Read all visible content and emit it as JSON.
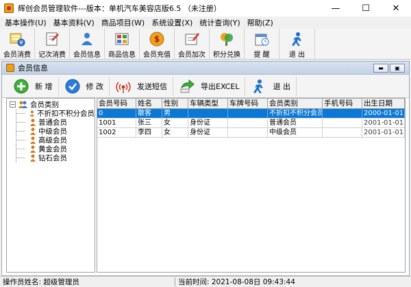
{
  "app": {
    "title": "辉创会员管理软件---版本：单机汽车美容店版6.5 （未注册）"
  },
  "window_controls": {
    "minimize": "—",
    "maximize": "☐",
    "close": "✕"
  },
  "menu": [
    "基本操作(U)",
    "基本资料(V)",
    "商品项目(W)",
    "系统设置(X)",
    "统计查询(Y)",
    "帮助(Z)"
  ],
  "toolbar": [
    {
      "label": "会员消费",
      "icon": "member-consume-icon"
    },
    {
      "label": "记次消费",
      "icon": "count-consume-icon"
    },
    {
      "label": "会员信息",
      "icon": "member-info-icon"
    },
    {
      "label": "商品信息",
      "icon": "product-info-icon"
    },
    {
      "label": "会员充值",
      "icon": "recharge-icon"
    },
    {
      "label": "会员加次",
      "icon": "add-count-icon"
    },
    {
      "label": "积分兑换",
      "icon": "points-exchange-icon"
    },
    {
      "label": "提  醒",
      "icon": "reminder-icon"
    },
    {
      "label": "退  出",
      "icon": "exit-icon"
    }
  ],
  "child_window": {
    "title": "会员信息",
    "buttons": {
      "minimize": "▬",
      "restore": "▣"
    },
    "actions": [
      {
        "label": "新  增",
        "icon": "add-icon"
      },
      {
        "label": "修  改",
        "icon": "edit-icon"
      },
      {
        "label": "发送短信",
        "icon": "sms-icon"
      },
      {
        "label": "导出EXCEL",
        "icon": "export-excel-icon"
      },
      {
        "label": "退  出",
        "icon": "exit-icon"
      }
    ]
  },
  "tree": {
    "root": "会员类别",
    "toggle": "−",
    "children": [
      "不折扣不积分会员",
      "普通会员",
      "中级会员",
      "高级会员",
      "黄金会员",
      "钻石会员"
    ]
  },
  "grid": {
    "columns": [
      "会员号码",
      "姓名",
      "性别",
      "车辆类型",
      "车牌号码",
      "会员类别",
      "手机号码",
      "出生日期"
    ],
    "rows": [
      [
        "0",
        "散客",
        "男",
        "",
        "",
        "不折扣不积分会员",
        "",
        "2000-01-01"
      ],
      [
        "1001",
        "张三",
        "女",
        "身份证",
        "",
        "普通会员",
        "",
        "2001-01-01"
      ],
      [
        "1002",
        "李四",
        "女",
        "身份证",
        "",
        "中级会员",
        "",
        "2001-01-01"
      ]
    ],
    "selected_row": 0
  },
  "status": {
    "operator": "操作员姓名:  超级管理员",
    "time": "当前时间:  2021-08-08日 09:43:44"
  },
  "colors": {
    "selection": "#0a78d6"
  }
}
